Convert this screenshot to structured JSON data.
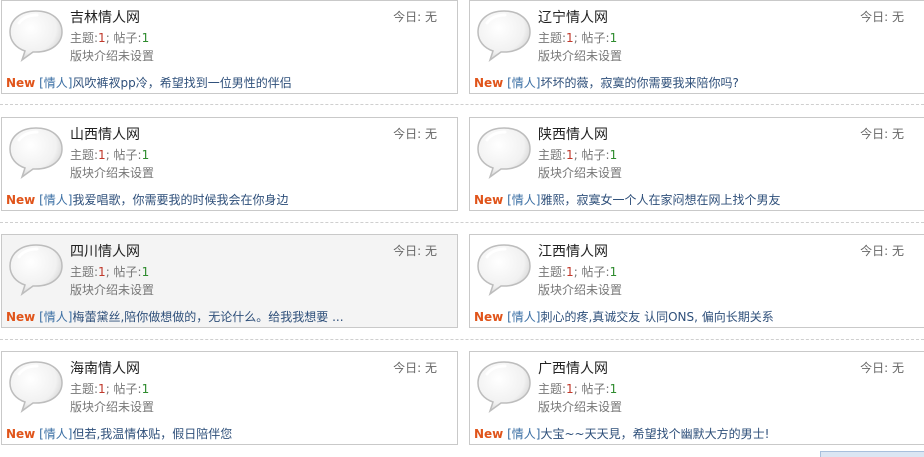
{
  "common": {
    "today_label": "今日: 无",
    "topics_label": "主题:",
    "posts_label": "帖子:",
    "separator": "; ",
    "desc": "版块介绍未设置",
    "new_label": "New",
    "tag": "[情人]"
  },
  "forums": [
    {
      "name": "吉林情人网",
      "topics": "1",
      "posts": "1",
      "latest": "风吹裤衩pp冷，希望找到一位男性的伴侣"
    },
    {
      "name": "辽宁情人网",
      "topics": "1",
      "posts": "1",
      "latest": "坏坏的薇，寂寞的你需要我来陪你吗?"
    },
    {
      "name": "山西情人网",
      "topics": "1",
      "posts": "1",
      "latest": "我爱唱歌，你需要我的时候我会在你身边"
    },
    {
      "name": "陕西情人网",
      "topics": "1",
      "posts": "1",
      "latest": "雅熙，寂寞女一个人在家闷想在网上找个男友"
    },
    {
      "name": "四川情人网",
      "topics": "1",
      "posts": "1",
      "latest": "梅蕾黛丝,陪你做想做的，无论什么。给我我想要 ..."
    },
    {
      "name": "江西情人网",
      "topics": "1",
      "posts": "1",
      "latest": "刺心的疼,真诚交友 认同ONS, 偏向长期关系"
    },
    {
      "name": "海南情人网",
      "topics": "1",
      "posts": "1",
      "latest": "但若,我温情体贴，假日陪伴您"
    },
    {
      "name": "广西情人网",
      "topics": "1",
      "posts": "1",
      "latest": "大宝~~天天見，希望找个幽默大方的男士!"
    }
  ]
}
